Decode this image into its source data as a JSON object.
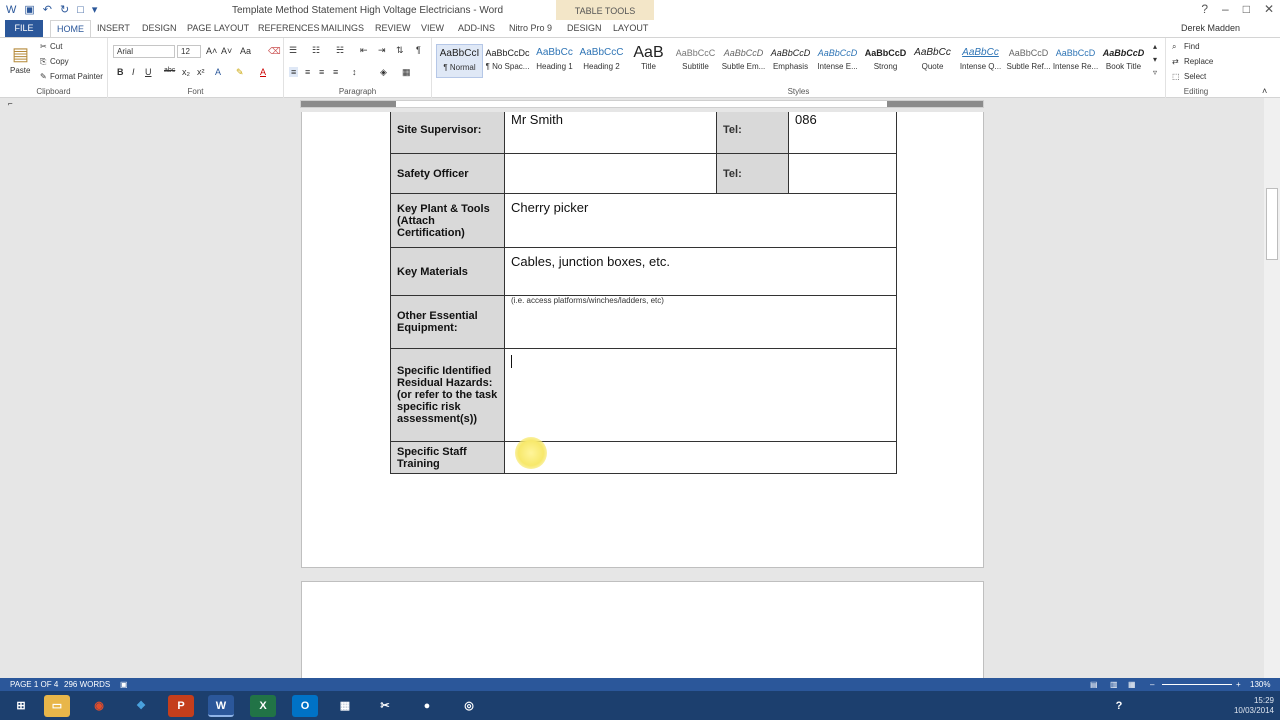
{
  "window": {
    "title": "Template Method Statement High Voltage Electricians - Word",
    "context_tab": "TABLE TOOLS",
    "user": "Derek Madden"
  },
  "tabs": {
    "file": "FILE",
    "items": [
      "HOME",
      "INSERT",
      "DESIGN",
      "PAGE LAYOUT",
      "REFERENCES",
      "MAILINGS",
      "REVIEW",
      "VIEW",
      "ADD-INS",
      "Nitro Pro 9",
      "DESIGN",
      "LAYOUT"
    ],
    "active": "HOME"
  },
  "ribbon": {
    "clipboard": {
      "paste": "Paste",
      "cut": "Cut",
      "copy": "Copy",
      "format_painter": "Format Painter",
      "label": "Clipboard"
    },
    "font": {
      "name": "Arial",
      "size": "12",
      "label": "Font"
    },
    "paragraph": {
      "label": "Paragraph"
    },
    "styles": {
      "label": "Styles",
      "items": [
        {
          "preview": "AaBbCcI",
          "name": "¶ Normal"
        },
        {
          "preview": "AaBbCcDc",
          "name": "¶ No Spac..."
        },
        {
          "preview": "AaBbCc",
          "name": "Heading 1"
        },
        {
          "preview": "AaBbCcC",
          "name": "Heading 2"
        },
        {
          "preview": "AaB",
          "name": "Title"
        },
        {
          "preview": "AaBbCcC",
          "name": "Subtitle"
        },
        {
          "preview": "AaBbCcD",
          "name": "Subtle Em..."
        },
        {
          "preview": "AaBbCcD",
          "name": "Emphasis"
        },
        {
          "preview": "AaBbCcD",
          "name": "Intense E..."
        },
        {
          "preview": "AaBbCcD",
          "name": "Strong"
        },
        {
          "preview": "AaBbCc",
          "name": "Quote"
        },
        {
          "preview": "AaBbCc",
          "name": "Intense Q..."
        },
        {
          "preview": "AaBbCcD",
          "name": "Subtle Ref..."
        },
        {
          "preview": "AaBbCcD",
          "name": "Intense Re..."
        },
        {
          "preview": "AaBbCcD",
          "name": "Book Title"
        }
      ]
    },
    "editing": {
      "find": "Find",
      "replace": "Replace",
      "select": "Select",
      "label": "Editing"
    }
  },
  "table": {
    "site_supervisor_label": "Site Supervisor:",
    "site_supervisor_value": "Mr Smith",
    "tel_label": "Tel:",
    "site_supervisor_tel": "086",
    "safety_officer_label": "Safety Officer",
    "safety_tel_label": "Tel:",
    "plant_label": "Key Plant & Tools (Attach Certification)",
    "plant_value": "Cherry picker",
    "materials_label": "Key Materials",
    "materials_value": "Cables, junction boxes, etc.",
    "equipment_label": "Other Essential Equipment:",
    "equipment_note": "(i.e. access platforms/winches/ladders, etc)",
    "hazards_label": "Specific Identified Residual Hazards: (or refer to the task specific risk assessment(s))",
    "training_label": "Specific Staff Training"
  },
  "status": {
    "page": "PAGE 1 OF 4",
    "words": "296 WORDS",
    "zoom": "130%"
  },
  "tray": {
    "time": "15:29",
    "date": "10/03/2014"
  }
}
